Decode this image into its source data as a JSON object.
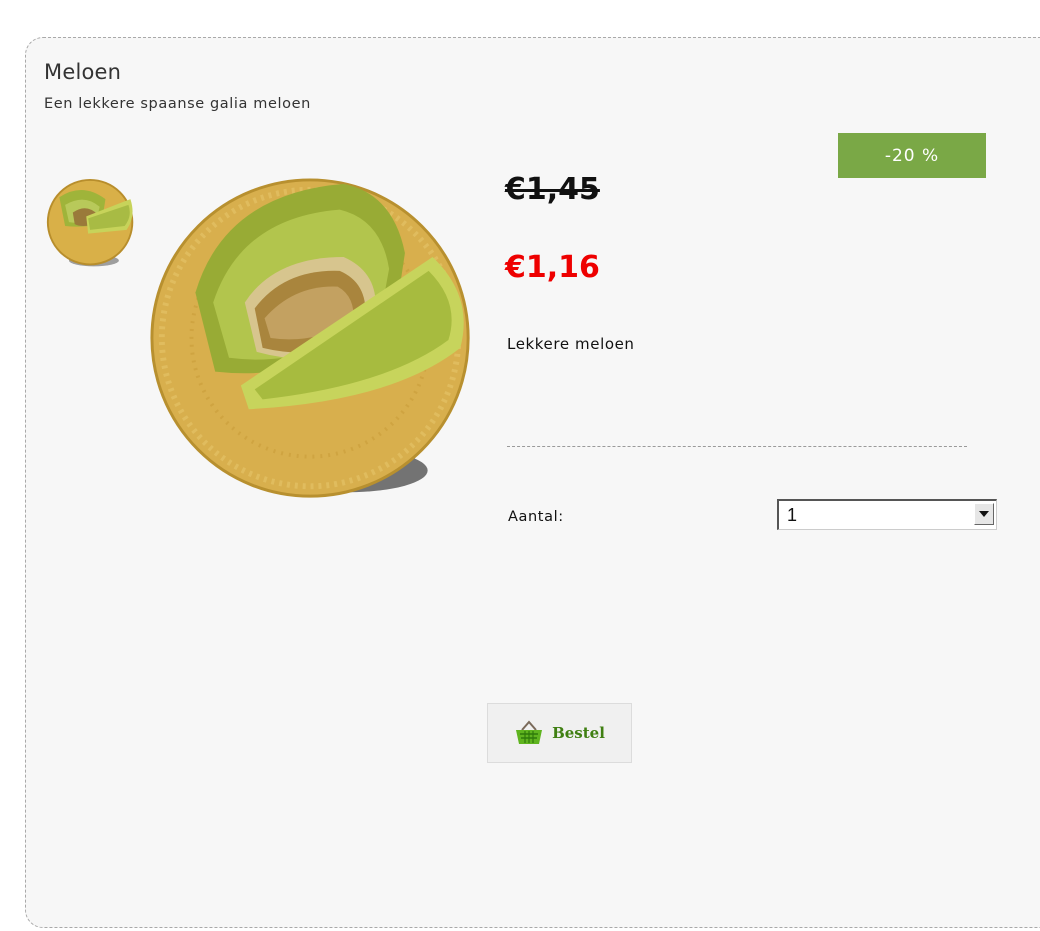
{
  "product": {
    "title": "Meloen",
    "subtitle": "Een lekkere spaanse galia meloen",
    "description": "Lekkere meloen"
  },
  "pricing": {
    "discount_badge": "-20 %",
    "old_price": "€1,45",
    "new_price": "€1,16"
  },
  "quantity": {
    "label": "Aantal:",
    "selected": "1"
  },
  "order_button": {
    "label": "Bestel",
    "icon": "basket-icon"
  },
  "colors": {
    "badge_green": "#7aa846",
    "new_price_red": "#ee0000",
    "button_text_green": "#3f7f12"
  }
}
